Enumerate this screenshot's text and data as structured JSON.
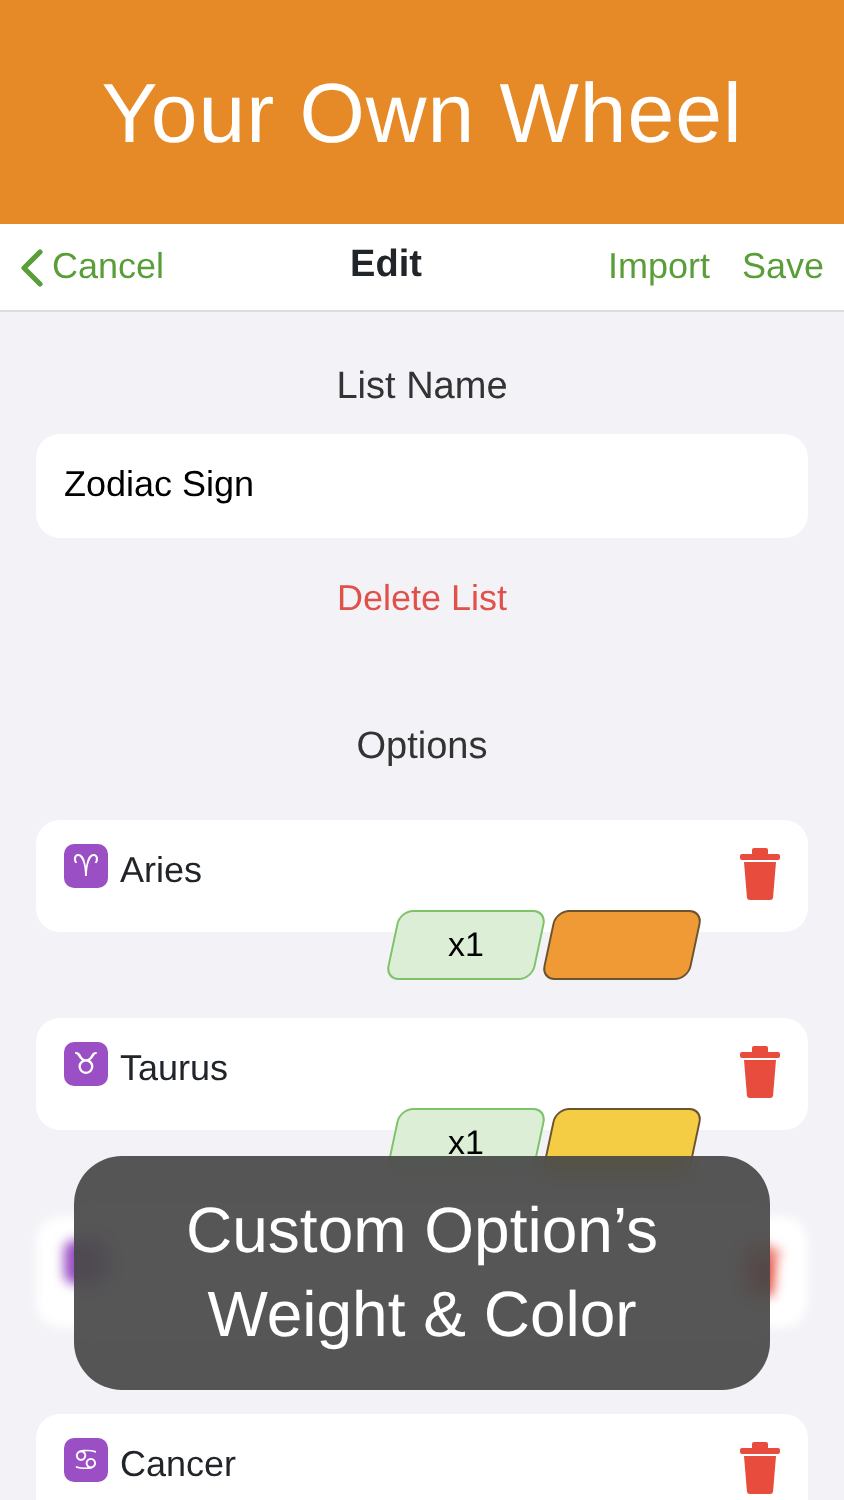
{
  "banner": {
    "title": "Your Own Wheel"
  },
  "nav": {
    "back": "Cancel",
    "title": "Edit",
    "actions": [
      "Import",
      "Save"
    ]
  },
  "list_name": {
    "label": "List Name",
    "value": "Zodiac Sign"
  },
  "delete_button": "Delete List",
  "options_label": "Options",
  "options": [
    {
      "symbol": "♈",
      "name": "Aries",
      "weight": "x1",
      "color": "#f09a35"
    },
    {
      "symbol": "♉",
      "name": "Taurus",
      "weight": "x1",
      "color": "#f5cd45"
    },
    {
      "kind": "covered"
    },
    {
      "symbol": "♋",
      "name": "Cancer"
    }
  ],
  "caption": "Custom Option’s\nWeight & Color"
}
